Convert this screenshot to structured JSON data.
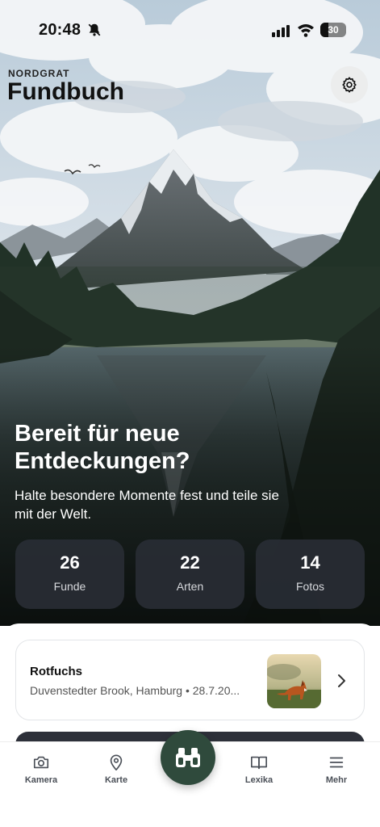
{
  "status_bar": {
    "time": "20:48",
    "battery": "30",
    "battery_level": 0.3,
    "icons": [
      "bell-slash-icon",
      "cellular-signal-icon",
      "wifi-icon",
      "battery-icon"
    ]
  },
  "header": {
    "brand": "NORDGRAT",
    "title": "Fundbuch",
    "settings_icon": "gear-icon"
  },
  "hero": {
    "headline": "Bereit für neue Entdeckungen?",
    "subtitle": "Halte besondere Momente fest und teile sie mit der Welt."
  },
  "stats": [
    {
      "value": "26",
      "label": "Funde"
    },
    {
      "value": "22",
      "label": "Arten"
    },
    {
      "value": "14",
      "label": "Fotos"
    }
  ],
  "recent_find": {
    "title": "Rotfuchs",
    "subtitle": "Duvenstedter Brook, Hamburg • 28.7.20...",
    "thumbnail": "fox-photo"
  },
  "tab_bar": {
    "items": [
      {
        "label": "Kamera",
        "icon": "camera-icon"
      },
      {
        "label": "Karte",
        "icon": "map-pin-icon"
      },
      {
        "label": "Lexika",
        "icon": "book-icon"
      },
      {
        "label": "Mehr",
        "icon": "menu-icon"
      }
    ],
    "center_action_icon": "binoculars-icon"
  },
  "colors": {
    "stat_card": "#2b2f38",
    "fab": "#2f4a3c",
    "tab_label": "#4a4f57"
  }
}
